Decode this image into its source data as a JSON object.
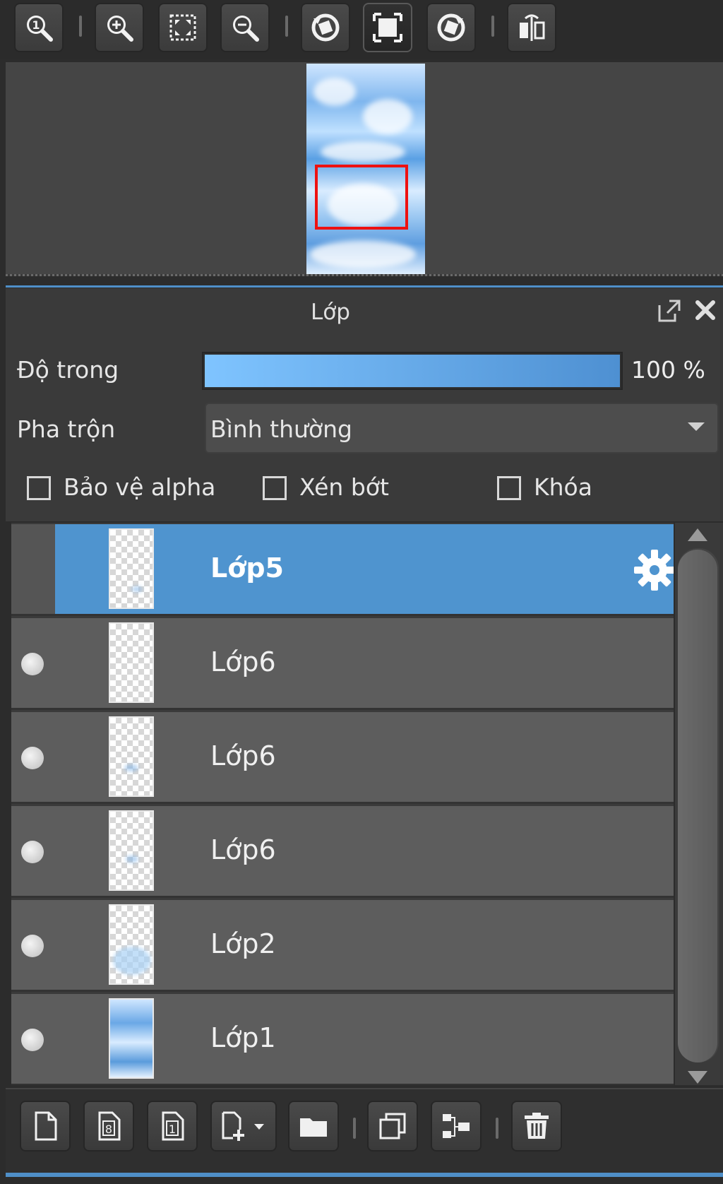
{
  "navigator": {
    "toolbar": {
      "buttons": [
        {
          "name": "zoom-actual-size",
          "icon": "zoom-one-icon"
        },
        {
          "name": "zoom-in",
          "icon": "zoom-in-icon"
        },
        {
          "name": "fit-to-window",
          "icon": "fit-screen-icon"
        },
        {
          "name": "zoom-out",
          "icon": "zoom-out-icon"
        },
        {
          "name": "rotate-left",
          "icon": "rotate-left-icon"
        },
        {
          "name": "reset-view",
          "icon": "reset-view-icon"
        },
        {
          "name": "rotate-right",
          "icon": "rotate-right-icon"
        },
        {
          "name": "flip-horizontal",
          "icon": "flip-horizontal-icon"
        }
      ],
      "active_button": "reset-view"
    },
    "view_rect_color": "#ee1111"
  },
  "layer_panel": {
    "title": "Lớp",
    "opacity_label": "Độ trong",
    "opacity_value": "100 %",
    "opacity_fraction": 1.0,
    "blend_label": "Pha trộn",
    "blend_value": "Bình thường",
    "checkboxes": [
      {
        "label": "Bảo vệ alpha",
        "checked": false
      },
      {
        "label": "Xén bớt",
        "checked": false
      },
      {
        "label": "Khóa",
        "checked": false
      }
    ],
    "layers": [
      {
        "name": "Lớp5",
        "selected": true,
        "visible_dot": false
      },
      {
        "name": "Lớp6",
        "selected": false,
        "visible_dot": true
      },
      {
        "name": "Lớp6",
        "selected": false,
        "visible_dot": true
      },
      {
        "name": "Lớp6",
        "selected": false,
        "visible_dot": true
      },
      {
        "name": "Lớp2",
        "selected": false,
        "visible_dot": true
      },
      {
        "name": "Lớp1",
        "selected": false,
        "visible_dot": true
      }
    ],
    "selection_color": "#4f94cf",
    "accent_color": "#4f8fc8"
  },
  "bottom_toolbar": {
    "buttons": [
      {
        "name": "new-layer",
        "icon": "new-page-icon"
      },
      {
        "name": "new-8bit-layer",
        "icon": "page-8-icon"
      },
      {
        "name": "new-1bit-layer",
        "icon": "page-1-icon"
      },
      {
        "name": "add-layer-menu",
        "icon": "add-page-dropdown-icon"
      },
      {
        "name": "new-folder",
        "icon": "folder-icon"
      },
      {
        "name": "duplicate-layer",
        "icon": "duplicate-icon"
      },
      {
        "name": "merge-down",
        "icon": "merge-down-icon"
      },
      {
        "name": "delete-layer",
        "icon": "trash-icon"
      }
    ]
  }
}
